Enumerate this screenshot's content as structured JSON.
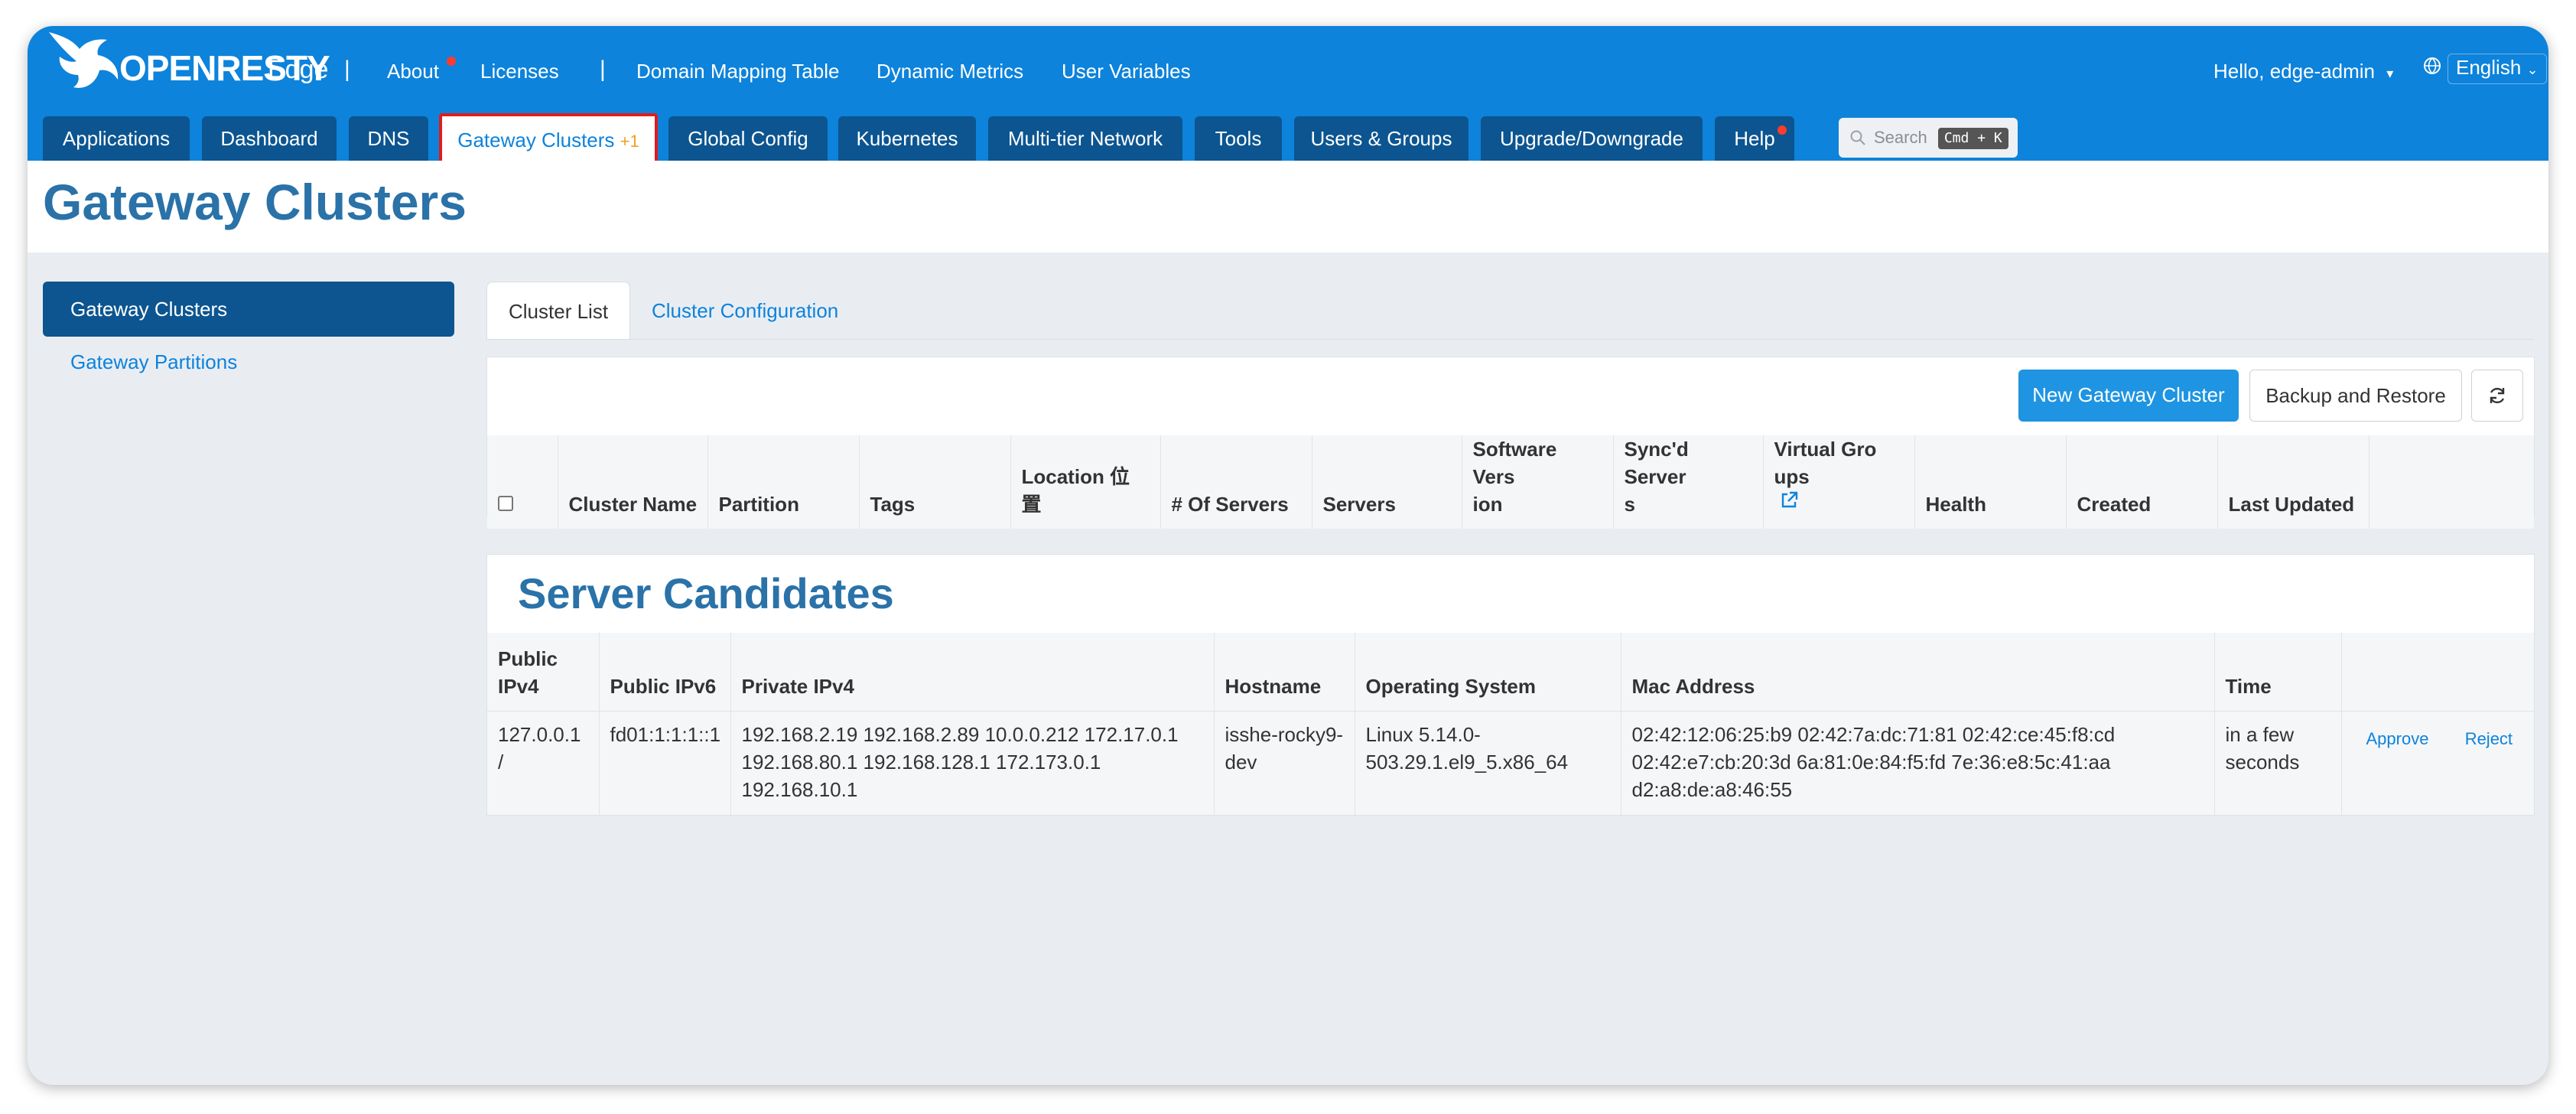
{
  "brand": {
    "logo_text": "OPENRESTY",
    "product": "Edge"
  },
  "top_links": [
    "About",
    "Licenses",
    "Domain Mapping Table",
    "Dynamic Metrics",
    "User Variables"
  ],
  "user_menu": "Hello, edge-admin",
  "language": "English",
  "nav_tabs": [
    "Applications",
    "Dashboard",
    "DNS",
    "Gateway Clusters",
    "Global Config",
    "Kubernetes",
    "Multi-tier Network",
    "Tools",
    "Users & Groups",
    "Upgrade/Downgrade",
    "Help"
  ],
  "active_tab_badge": "+1",
  "search": {
    "placeholder": "Search",
    "shortcut": "Cmd + K"
  },
  "page_title": "Gateway Clusters",
  "sidebar": {
    "items": [
      "Gateway Clusters",
      "Gateway Partitions"
    ],
    "active_index": 0
  },
  "sub_tabs": [
    "Cluster List",
    "Cluster Configuration"
  ],
  "buttons": {
    "new_cluster": "New Gateway Cluster",
    "backup": "Backup and Restore"
  },
  "cluster_table": {
    "columns": [
      "Cluster Name",
      "Partition",
      "Tags",
      "Location 位\n置",
      "# Of Servers",
      "Servers",
      "Software Vers\nion",
      "Sync'd Server\ns",
      "Virtual Gro\nups",
      "Health",
      "Created",
      "Last Updated"
    ],
    "rows": []
  },
  "candidates": {
    "title": "Server Candidates",
    "columns": [
      "Public\nIPv4",
      "Public IPv6",
      "Private IPv4",
      "Hostname",
      "Operating System",
      "Mac Address",
      "Time"
    ],
    "rows": [
      {
        "public_ipv4": "127.0.0.1\n/",
        "public_ipv6": "fd01:1:1:1::1",
        "private_ipv4": "192.168.2.19 192.168.2.89 10.0.0.212 172.17.0.1\n192.168.80.1 192.168.128.1 172.173.0.1\n192.168.10.1",
        "hostname": "isshe-rocky9-\ndev",
        "os": "Linux 5.14.0-\n503.29.1.el9_5.x86_64",
        "mac": "02:42:12:06:25:b9 02:42:7a:dc:71:81 02:42:ce:45:f8:cd\n02:42:e7:cb:20:3d 6a:81:0e:84:f5:fd 7e:36:e8:5c:41:aa\nd2:a8:de:a8:46:55",
        "time": "in a few\nseconds",
        "approve": "Approve",
        "reject": "Reject"
      }
    ]
  },
  "colors": {
    "header_blue": "#0d83db",
    "dark_tab": "#0c5590",
    "title_blue": "#2a72a8",
    "active_outline": "#e21b1b"
  }
}
